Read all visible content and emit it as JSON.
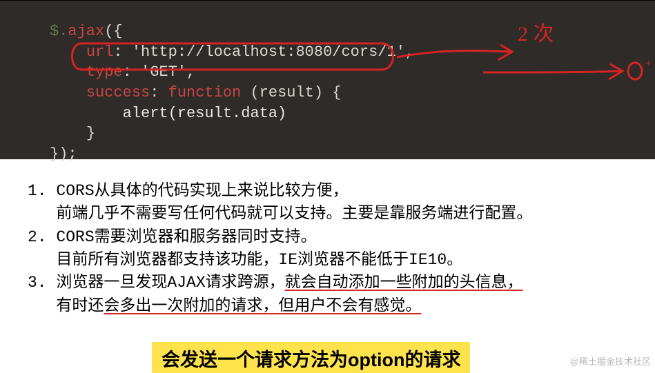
{
  "code": {
    "line1_a": "$.",
    "line1_b": "ajax",
    "line1_c": "({",
    "line2_key": "url",
    "line2_sep": ": ",
    "line2_str": "'http://localhost:8080/cors/1'",
    "line2_end": ",",
    "line3_key": "type",
    "line3_sep": ": ",
    "line3_str": "'GET'",
    "line3_end": ",",
    "line4_key": "success",
    "line4_sep": ": ",
    "line4_fn": "function",
    "line4_rest": " (result) {",
    "line5": "alert(result.data)",
    "line6": "}",
    "line7": "});"
  },
  "annotation": {
    "top_label": "2 次",
    "arrow_target": "0"
  },
  "notes": {
    "n1a": "1. CORS从具体的代码实现上来说比较方便，",
    "n1b": "   前端几乎不需要写任何代码就可以支持。主要是靠服务端进行配置。",
    "n2a": "2. CORS需要浏览器和服务器同时支持。",
    "n2b": "   目前所有浏览器都支持该功能，IE浏览器不能低于IE10。",
    "n3a_pre": "3. 浏览器一旦发现AJAX请求跨源，",
    "n3a_ul": "就会自动添加一些附加的头信息，",
    "n3b_pre": "   有时还",
    "n3b_ul": "会多出一次附加的请求，但用户不会有感觉。"
  },
  "highlight": "会发送一个请求方法为option的请求",
  "watermark": "@稀土掘金技术社区"
}
